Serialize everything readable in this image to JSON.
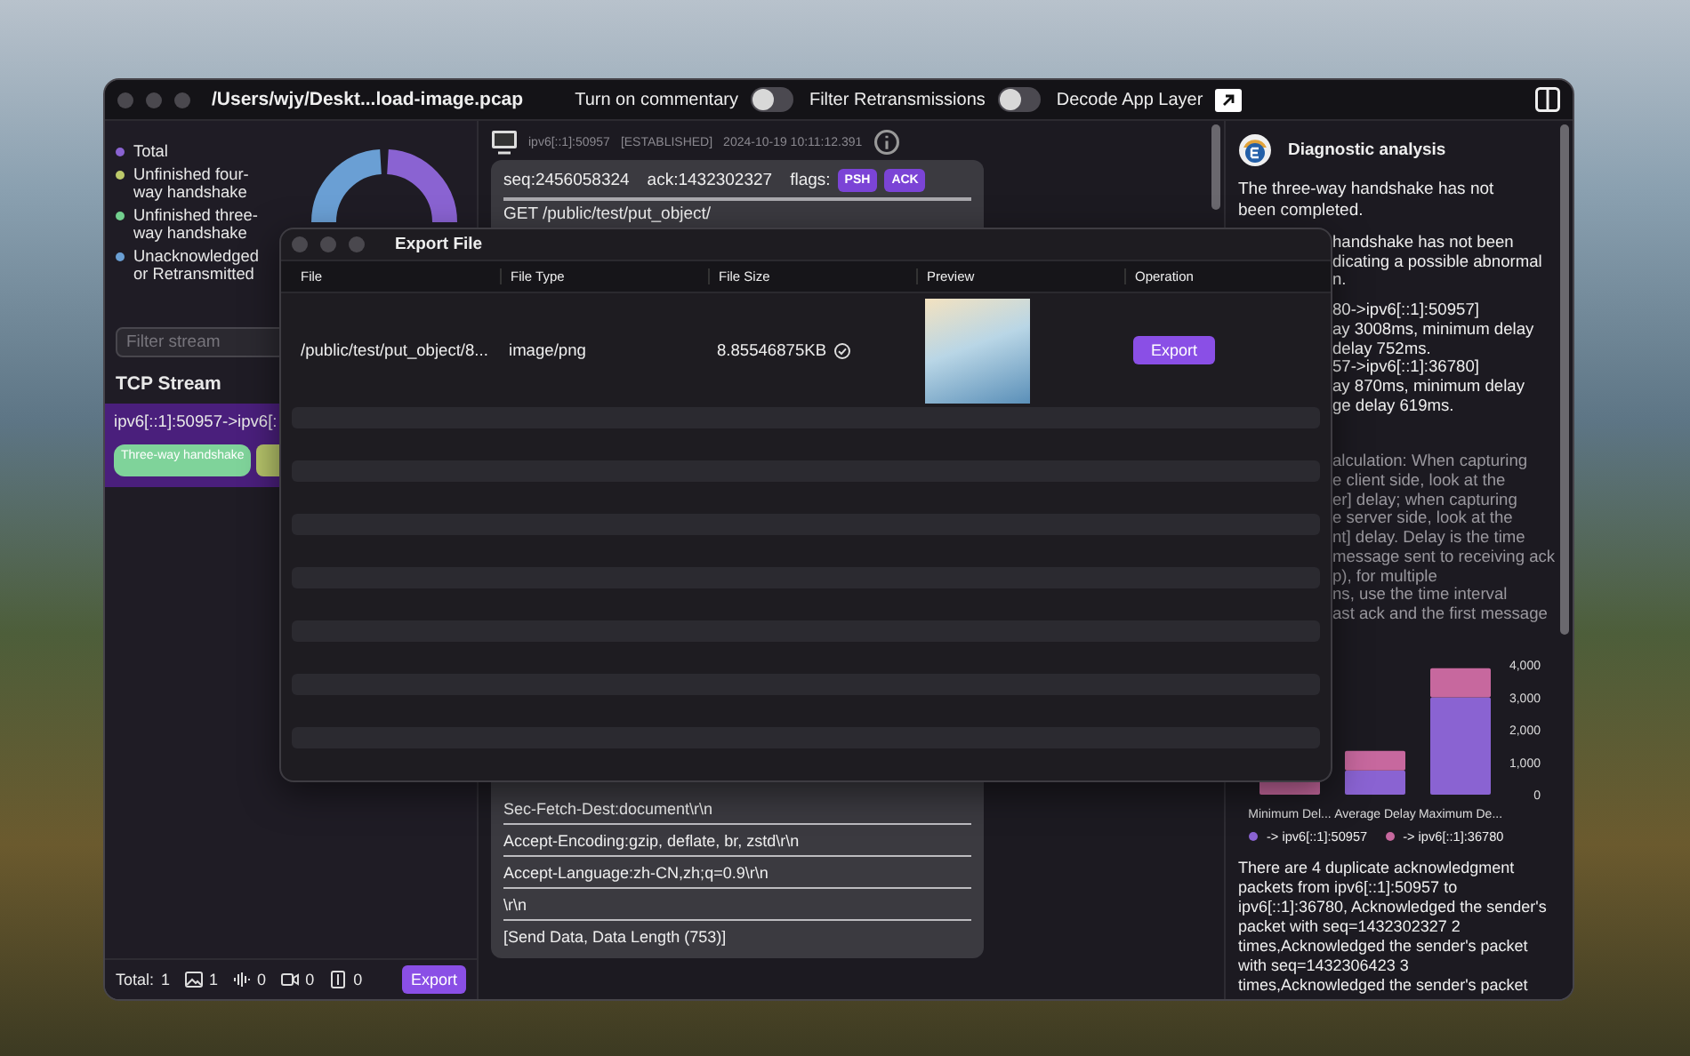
{
  "window": {
    "title": "/Users/wjy/Deskt...load-image.pcap"
  },
  "toolbar": {
    "toggles": [
      {
        "label": "Turn on commentary",
        "on": false
      },
      {
        "label": "Filter Retransmissions",
        "on": false
      }
    ],
    "decode_label": "Decode App Layer"
  },
  "sidebar": {
    "legend": [
      {
        "label": "Total",
        "color": "#8a63d2"
      },
      {
        "label": "Unfinished four-way handshake",
        "color": "#bcc96a"
      },
      {
        "label": "Unfinished three-way handshake",
        "color": "#72cf8e"
      },
      {
        "label": "Unacknowledged or Retransmitted",
        "color": "#6a9fd4"
      }
    ],
    "filter": {
      "placeholder": "Filter stream"
    },
    "section_title": "TCP Stream",
    "streams": [
      {
        "name": "ipv6[::1]:50957->ipv6[:",
        "selected": true,
        "tags": [
          {
            "label": "Three-way handshake",
            "color": "#7fd39a"
          },
          {
            "color": "#b6c46a"
          }
        ]
      }
    ],
    "footer": {
      "total_label": "Total:",
      "counts": [
        {
          "kind": "total",
          "value": "1"
        },
        {
          "kind": "image",
          "value": "1"
        },
        {
          "kind": "audio",
          "value": "0"
        },
        {
          "kind": "video",
          "value": "0"
        },
        {
          "kind": "document",
          "value": "0"
        }
      ],
      "export_button": "Export"
    }
  },
  "packets": {
    "header": {
      "address": "ipv6[::1]:50957",
      "state": "[ESTABLISHED]",
      "time": "2024-10-19 10:11:12.391"
    },
    "seq": "seq:2456058324",
    "ack": "ack:1432302327",
    "flags_label": "flags:",
    "flags": [
      "PSH",
      "ACK"
    ],
    "lines_top": [
      "GET /public/test/put_object/"
    ],
    "lines_bottom": [
      "Sec-Fetch-Dest:document\\r\\n",
      "Accept-Encoding:gzip, deflate, br, zstd\\r\\n",
      "Accept-Language:zh-CN,zh;q=0.9\\r\\n",
      "\\r\\n",
      "[Send Data, Data Length (753)]"
    ]
  },
  "dialog": {
    "title": "Export File",
    "columns": [
      "File",
      "File Type",
      "File Size",
      "Preview",
      "Operation"
    ],
    "rows": [
      {
        "file": "/public/test/put_object/8...",
        "type": "image/png",
        "size": "8.85546875KB",
        "verified": true,
        "button": "Export"
      }
    ]
  },
  "diagnosis": {
    "title": "Diagnostic analysis",
    "summary": "The three-way handshake has not been completed.",
    "covered_paragraphs": [
      {
        "muted": false,
        "lines": [
          "handshake has not been",
          "dicating a possible abnormal",
          "n."
        ]
      },
      {
        "muted": false,
        "lines": [
          "80->ipv6[::1]:50957]",
          "ay 3008ms, minimum delay",
          "delay 752ms.",
          "57->ipv6[::1]:36780]",
          "ay 870ms, minimum delay",
          "ge delay 619ms."
        ]
      },
      {
        "muted": true,
        "lines": [
          "alculation: When capturing",
          "e client side, look at the",
          "er] delay; when capturing",
          "e server side, look at the",
          "nt] delay. Delay is the time",
          "message sent to receiving ack",
          "p), for multiple",
          "ns, use the time interval",
          "ast ack and the first message"
        ]
      }
    ],
    "chart_data": {
      "type": "bar",
      "stacked": true,
      "categories": [
        "Minimum Del...",
        "Average Delay",
        "Maximum De..."
      ],
      "legend": "bottom",
      "series": [
        {
          "name": "-> ipv6[::1]:50957",
          "color": "#8a63d2",
          "values": [
            0,
            750,
            3000
          ]
        },
        {
          "name": "-> ipv6[::1]:36780",
          "color": "#c7689e",
          "values": [
            500,
            600,
            900
          ]
        }
      ],
      "ylim": [
        0,
        4000
      ],
      "yticks": [
        {
          "value": 0,
          "label": "0"
        },
        {
          "value": 1000,
          "label": "1,000"
        },
        {
          "value": 2000,
          "label": "2,000"
        },
        {
          "value": 3000,
          "label": "3,000"
        },
        {
          "value": 4000,
          "label": "4,000"
        }
      ]
    },
    "details": "There are 4 duplicate acknowledgment packets from ipv6[::1]:50957 to ipv6[::1]:36780, Acknowledged the sender's packet with seq=1432302327 2 times,Acknowledged the sender's packet with seq=1432306423 3 times,Acknowledged the sender's packet"
  }
}
